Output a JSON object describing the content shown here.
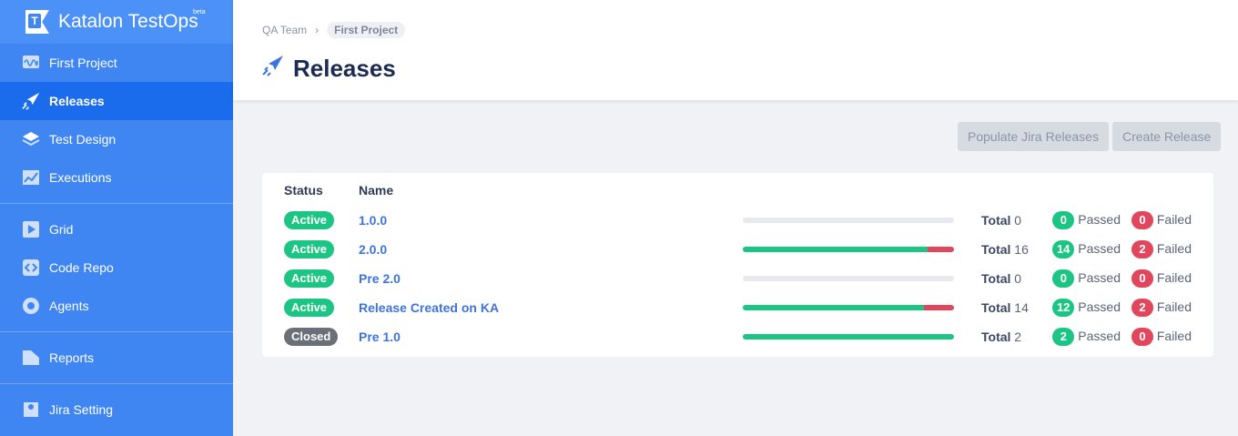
{
  "app": {
    "name": "Katalon TestOps",
    "beta": "beta"
  },
  "sidebar": {
    "items": [
      {
        "label": "First Project",
        "icon": "project-icon"
      },
      {
        "label": "Releases",
        "icon": "rocket-icon",
        "active": true
      },
      {
        "label": "Test Design",
        "icon": "layers-icon"
      },
      {
        "label": "Executions",
        "icon": "chart-icon"
      },
      {
        "label": "Grid",
        "icon": "play-icon"
      },
      {
        "label": "Code Repo",
        "icon": "code-icon"
      },
      {
        "label": "Agents",
        "icon": "agent-icon"
      },
      {
        "label": "Reports",
        "icon": "folder-icon"
      },
      {
        "label": "Jira Setting",
        "icon": "jira-icon"
      }
    ]
  },
  "breadcrumb": {
    "team": "QA Team",
    "project": "First Project"
  },
  "page": {
    "title": "Releases"
  },
  "buttons": {
    "populate": "Populate Jira Releases",
    "create": "Create Release"
  },
  "table": {
    "headers": {
      "status": "Status",
      "name": "Name"
    },
    "total_label": "Total",
    "passed_label": "Passed",
    "failed_label": "Failed",
    "rows": [
      {
        "status": "Active",
        "name": "1.0.0",
        "total": "0",
        "passed": "0",
        "failed": "0"
      },
      {
        "status": "Active",
        "name": "2.0.0",
        "total": "16",
        "passed": "14",
        "failed": "2"
      },
      {
        "status": "Active",
        "name": "Pre 2.0",
        "total": "0",
        "passed": "0",
        "failed": "0"
      },
      {
        "status": "Active",
        "name": "Release Created on KA",
        "total": "14",
        "passed": "12",
        "failed": "2"
      },
      {
        "status": "Closed",
        "name": "Pre 1.0",
        "total": "2",
        "passed": "2",
        "failed": "0"
      }
    ]
  },
  "colors": {
    "active": "#1dc584",
    "closed": "#6b6f78",
    "passed": "#1dc584",
    "failed": "#e0475d",
    "accent": "#3f86f3"
  }
}
